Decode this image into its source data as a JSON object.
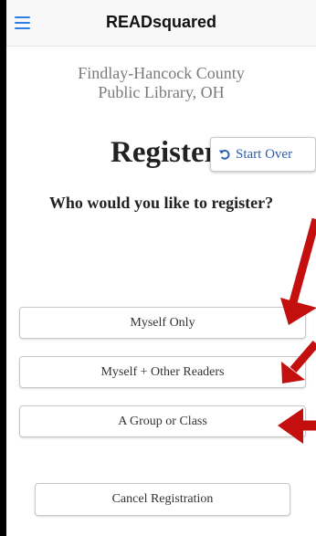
{
  "header": {
    "title": "READsquared",
    "menu_icon": "hamburger-menu-icon"
  },
  "library": {
    "line1": "Findlay-Hancock County",
    "line2": "Public Library, OH"
  },
  "page": {
    "heading": "Register",
    "question": "Who would you like to register?"
  },
  "start_over": {
    "label": "Start Over",
    "icon": "undo-icon"
  },
  "options": [
    {
      "label": "Myself Only"
    },
    {
      "label": "Myself + Other Readers"
    },
    {
      "label": "A Group or Class"
    }
  ],
  "cancel": {
    "label": "Cancel Registration"
  },
  "colors": {
    "accent": "#2d7fe0",
    "link": "#2a5db0",
    "annotation_arrow": "#c40f0f"
  }
}
